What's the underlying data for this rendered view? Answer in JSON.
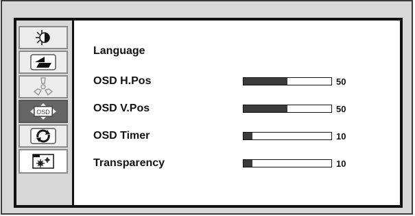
{
  "sidebar": {
    "tabs": [
      {
        "icon": "brightness-contrast-icon",
        "active": false
      },
      {
        "icon": "image-adjust-icon",
        "active": false
      },
      {
        "icon": "color-icon",
        "active": false
      },
      {
        "icon": "osd-settings-icon",
        "label": "OSD",
        "active": true
      },
      {
        "icon": "reset-icon",
        "active": false
      },
      {
        "icon": "other-settings-icon",
        "active": false
      }
    ]
  },
  "menu": {
    "items": [
      {
        "label": "Language"
      },
      {
        "label": "OSD H.Pos",
        "value": "50",
        "level": 0.5
      },
      {
        "label": "OSD V.Pos",
        "value": "50",
        "level": 0.5
      },
      {
        "label": "OSD Timer",
        "value": "10",
        "level": 0.1
      },
      {
        "label": "Transparency",
        "value": "10",
        "level": 0.1
      }
    ]
  },
  "colors": {
    "frame_bg": "#d7d7d7",
    "panel_bg": "#ffffff",
    "active_tab": "#666666",
    "bar_fill": "#3b3b3b"
  }
}
